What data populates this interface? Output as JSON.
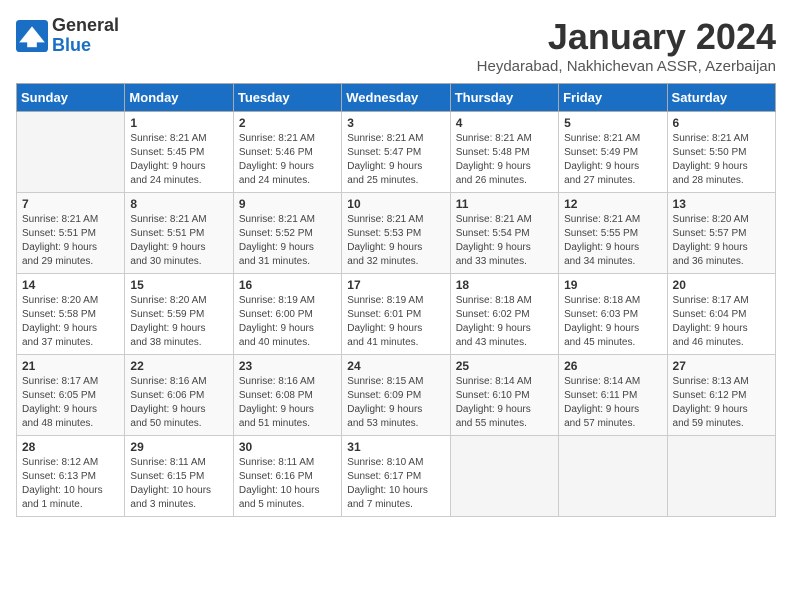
{
  "logo": {
    "general": "General",
    "blue": "Blue"
  },
  "title": "January 2024",
  "location": "Heydarabad, Nakhichevan ASSR, Azerbaijan",
  "headers": [
    "Sunday",
    "Monday",
    "Tuesday",
    "Wednesday",
    "Thursday",
    "Friday",
    "Saturday"
  ],
  "weeks": [
    [
      {
        "day": "",
        "info": ""
      },
      {
        "day": "1",
        "info": "Sunrise: 8:21 AM\nSunset: 5:45 PM\nDaylight: 9 hours\nand 24 minutes."
      },
      {
        "day": "2",
        "info": "Sunrise: 8:21 AM\nSunset: 5:46 PM\nDaylight: 9 hours\nand 24 minutes."
      },
      {
        "day": "3",
        "info": "Sunrise: 8:21 AM\nSunset: 5:47 PM\nDaylight: 9 hours\nand 25 minutes."
      },
      {
        "day": "4",
        "info": "Sunrise: 8:21 AM\nSunset: 5:48 PM\nDaylight: 9 hours\nand 26 minutes."
      },
      {
        "day": "5",
        "info": "Sunrise: 8:21 AM\nSunset: 5:49 PM\nDaylight: 9 hours\nand 27 minutes."
      },
      {
        "day": "6",
        "info": "Sunrise: 8:21 AM\nSunset: 5:50 PM\nDaylight: 9 hours\nand 28 minutes."
      }
    ],
    [
      {
        "day": "7",
        "info": "Sunrise: 8:21 AM\nSunset: 5:51 PM\nDaylight: 9 hours\nand 29 minutes."
      },
      {
        "day": "8",
        "info": "Sunrise: 8:21 AM\nSunset: 5:51 PM\nDaylight: 9 hours\nand 30 minutes."
      },
      {
        "day": "9",
        "info": "Sunrise: 8:21 AM\nSunset: 5:52 PM\nDaylight: 9 hours\nand 31 minutes."
      },
      {
        "day": "10",
        "info": "Sunrise: 8:21 AM\nSunset: 5:53 PM\nDaylight: 9 hours\nand 32 minutes."
      },
      {
        "day": "11",
        "info": "Sunrise: 8:21 AM\nSunset: 5:54 PM\nDaylight: 9 hours\nand 33 minutes."
      },
      {
        "day": "12",
        "info": "Sunrise: 8:21 AM\nSunset: 5:55 PM\nDaylight: 9 hours\nand 34 minutes."
      },
      {
        "day": "13",
        "info": "Sunrise: 8:20 AM\nSunset: 5:57 PM\nDaylight: 9 hours\nand 36 minutes."
      }
    ],
    [
      {
        "day": "14",
        "info": "Sunrise: 8:20 AM\nSunset: 5:58 PM\nDaylight: 9 hours\nand 37 minutes."
      },
      {
        "day": "15",
        "info": "Sunrise: 8:20 AM\nSunset: 5:59 PM\nDaylight: 9 hours\nand 38 minutes."
      },
      {
        "day": "16",
        "info": "Sunrise: 8:19 AM\nSunset: 6:00 PM\nDaylight: 9 hours\nand 40 minutes."
      },
      {
        "day": "17",
        "info": "Sunrise: 8:19 AM\nSunset: 6:01 PM\nDaylight: 9 hours\nand 41 minutes."
      },
      {
        "day": "18",
        "info": "Sunrise: 8:18 AM\nSunset: 6:02 PM\nDaylight: 9 hours\nand 43 minutes."
      },
      {
        "day": "19",
        "info": "Sunrise: 8:18 AM\nSunset: 6:03 PM\nDaylight: 9 hours\nand 45 minutes."
      },
      {
        "day": "20",
        "info": "Sunrise: 8:17 AM\nSunset: 6:04 PM\nDaylight: 9 hours\nand 46 minutes."
      }
    ],
    [
      {
        "day": "21",
        "info": "Sunrise: 8:17 AM\nSunset: 6:05 PM\nDaylight: 9 hours\nand 48 minutes."
      },
      {
        "day": "22",
        "info": "Sunrise: 8:16 AM\nSunset: 6:06 PM\nDaylight: 9 hours\nand 50 minutes."
      },
      {
        "day": "23",
        "info": "Sunrise: 8:16 AM\nSunset: 6:08 PM\nDaylight: 9 hours\nand 51 minutes."
      },
      {
        "day": "24",
        "info": "Sunrise: 8:15 AM\nSunset: 6:09 PM\nDaylight: 9 hours\nand 53 minutes."
      },
      {
        "day": "25",
        "info": "Sunrise: 8:14 AM\nSunset: 6:10 PM\nDaylight: 9 hours\nand 55 minutes."
      },
      {
        "day": "26",
        "info": "Sunrise: 8:14 AM\nSunset: 6:11 PM\nDaylight: 9 hours\nand 57 minutes."
      },
      {
        "day": "27",
        "info": "Sunrise: 8:13 AM\nSunset: 6:12 PM\nDaylight: 9 hours\nand 59 minutes."
      }
    ],
    [
      {
        "day": "28",
        "info": "Sunrise: 8:12 AM\nSunset: 6:13 PM\nDaylight: 10 hours\nand 1 minute."
      },
      {
        "day": "29",
        "info": "Sunrise: 8:11 AM\nSunset: 6:15 PM\nDaylight: 10 hours\nand 3 minutes."
      },
      {
        "day": "30",
        "info": "Sunrise: 8:11 AM\nSunset: 6:16 PM\nDaylight: 10 hours\nand 5 minutes."
      },
      {
        "day": "31",
        "info": "Sunrise: 8:10 AM\nSunset: 6:17 PM\nDaylight: 10 hours\nand 7 minutes."
      },
      {
        "day": "",
        "info": ""
      },
      {
        "day": "",
        "info": ""
      },
      {
        "day": "",
        "info": ""
      }
    ]
  ]
}
